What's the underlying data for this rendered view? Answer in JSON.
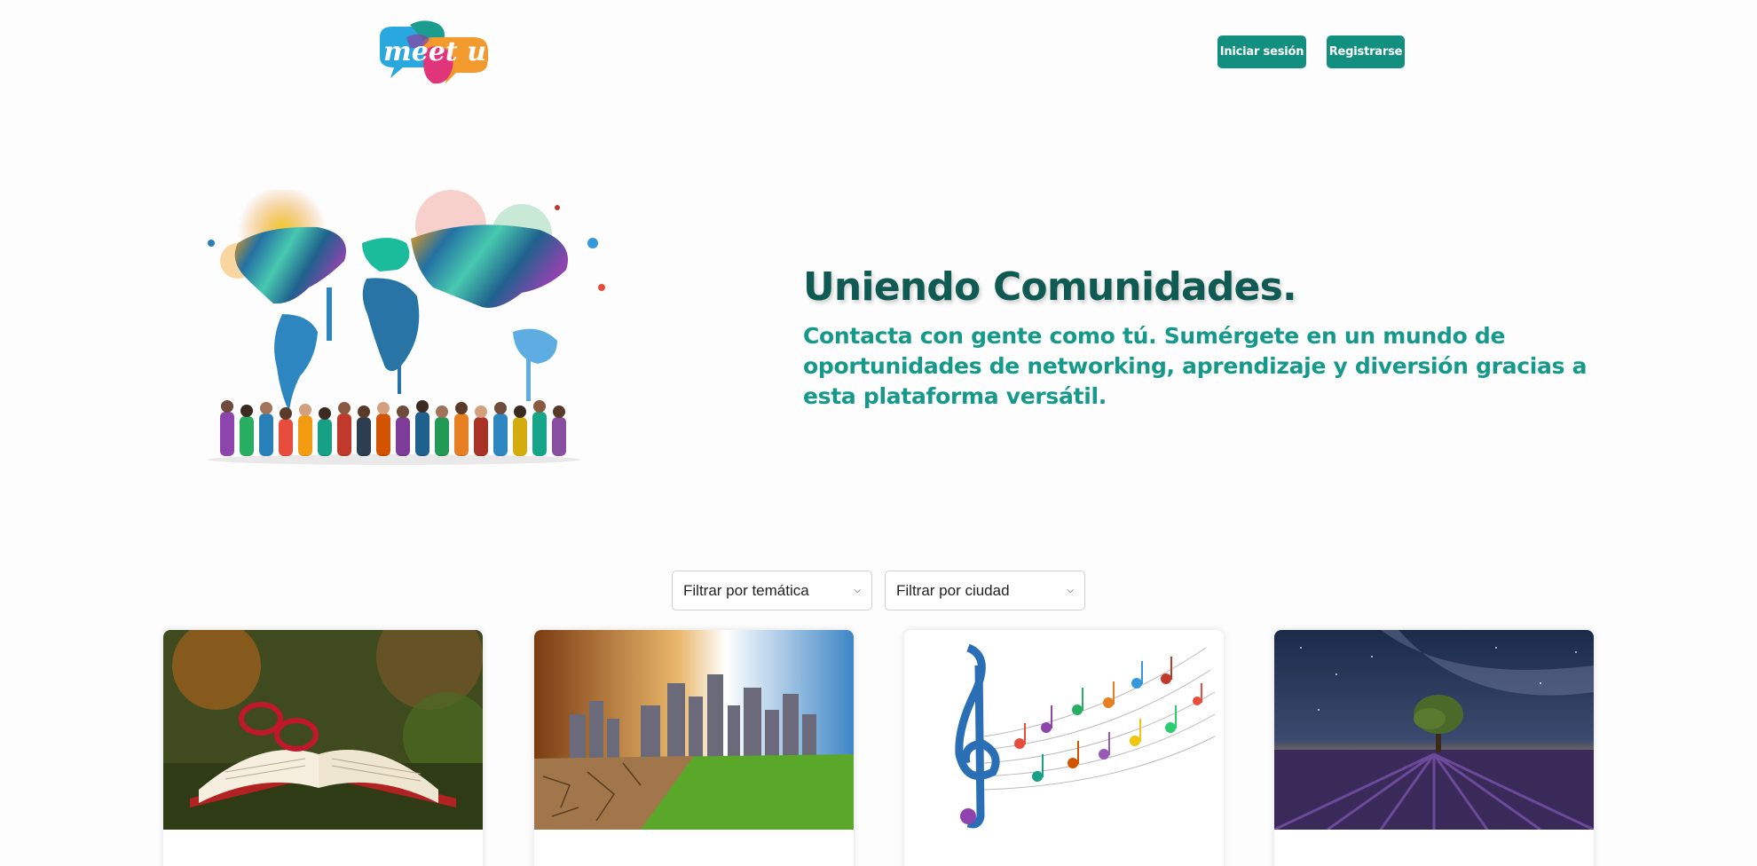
{
  "header": {
    "logo_text": "meet up",
    "login_label": "Iniciar sesión",
    "register_label": "Registrarse"
  },
  "hero": {
    "title": "Uniendo Comunidades.",
    "subtitle": "Contacta con gente como tú. Sumérgete en un mundo de oportunidades de networking, aprendizaje y diversión gracias a esta plataforma versátil."
  },
  "filters": {
    "topic_selected": "Filtrar por temática",
    "city_selected": "Filtrar por ciudad"
  },
  "colors": {
    "primary": "#138f80",
    "title": "#0f5a52",
    "subtitle": "#15998a"
  }
}
